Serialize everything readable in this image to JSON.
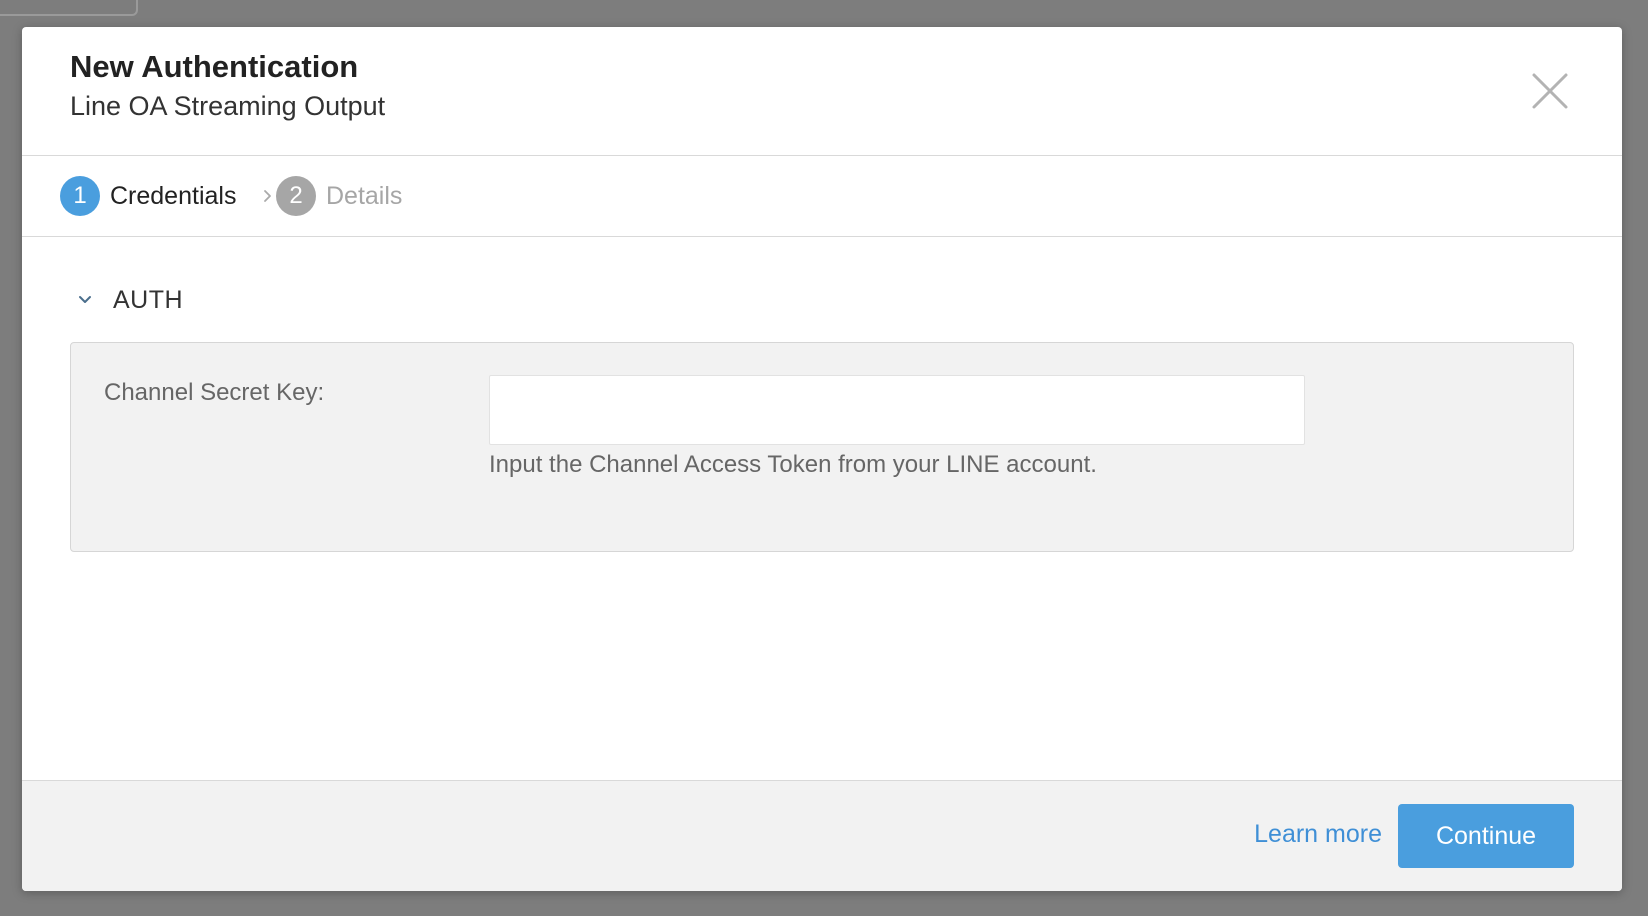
{
  "header": {
    "title": "New Authentication",
    "subtitle": "Line OA Streaming Output"
  },
  "steps": [
    {
      "number": "1",
      "label": "Credentials",
      "active": true
    },
    {
      "number": "2",
      "label": "Details",
      "active": false
    }
  ],
  "section": {
    "label": "AUTH"
  },
  "form": {
    "channel_secret": {
      "label": "Channel Secret Key:",
      "value": "",
      "placeholder": "",
      "help": "Input the Channel Access Token from your LINE account."
    }
  },
  "footer": {
    "learn_more": "Learn more",
    "continue": "Continue"
  },
  "icons": {
    "close": "close-icon",
    "step_separator": "chevron-right-icon",
    "section_toggle": "chevron-down-icon"
  },
  "colors": {
    "accent": "#4a9ede",
    "link": "#3f8fd6",
    "step_inactive": "#a6a6a6",
    "overlay": "#7d7d7d"
  }
}
